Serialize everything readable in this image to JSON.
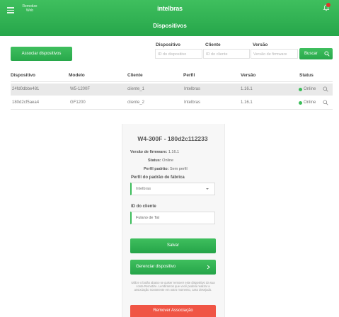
{
  "header": {
    "remote_line1": "Remotize",
    "remote_line2": "Web",
    "brand": "intelbras",
    "title": "Dispositivos"
  },
  "toolbar": {
    "associate_label": "Associar dispositivos",
    "device_label": "Dispositivo",
    "device_placeholder": "ID do dispositivo",
    "client_label": "Cliente",
    "client_placeholder": "ID do cliente",
    "version_label": "Versão",
    "version_placeholder": "Versão de firmware",
    "search_label": "Buscar"
  },
  "table": {
    "columns": [
      "Dispositivo",
      "Modelo",
      "Cliente",
      "Perfil",
      "Versão",
      "Status"
    ],
    "rows": [
      {
        "device": "24fd0dbbe481",
        "model": "W5-1200F",
        "client": "cliente_1",
        "profile": "Intelbras",
        "version": "1.16.1",
        "status": "Online"
      },
      {
        "device": "180d2cf5aea4",
        "model": "GF1200",
        "client": "cliente_2",
        "profile": "Intelbras",
        "version": "1.16.1",
        "status": "Online"
      }
    ]
  },
  "panel": {
    "title": "W4-300F - 180d2c112233",
    "firmware_label": "Versão de firmware:",
    "firmware_value": "1.16.1",
    "status_label": "Status:",
    "status_value": "Online",
    "profile_label": "Perfil padrão:",
    "profile_value": "Sem perfil",
    "factory_label": "Perfil do padrão de fábrica",
    "factory_value": "Intelbras",
    "client_id_label": "ID do cliente",
    "client_id_value": "Fulano de Tal",
    "save_label": "Salvar",
    "manage_label": "Gerenciar dispositivo",
    "warning_text": "Utilize o botão abaixo se quiser remover este dispositivo da sua conta Remotize. Lembramos que você poderá realizar a associação novamente em outro momento, caso desejado.",
    "remove_label": "Remover Associação"
  },
  "colors": {
    "primary_green": "#2fb152",
    "danger_red": "#f05545",
    "online_dot": "#3cbd5a"
  }
}
